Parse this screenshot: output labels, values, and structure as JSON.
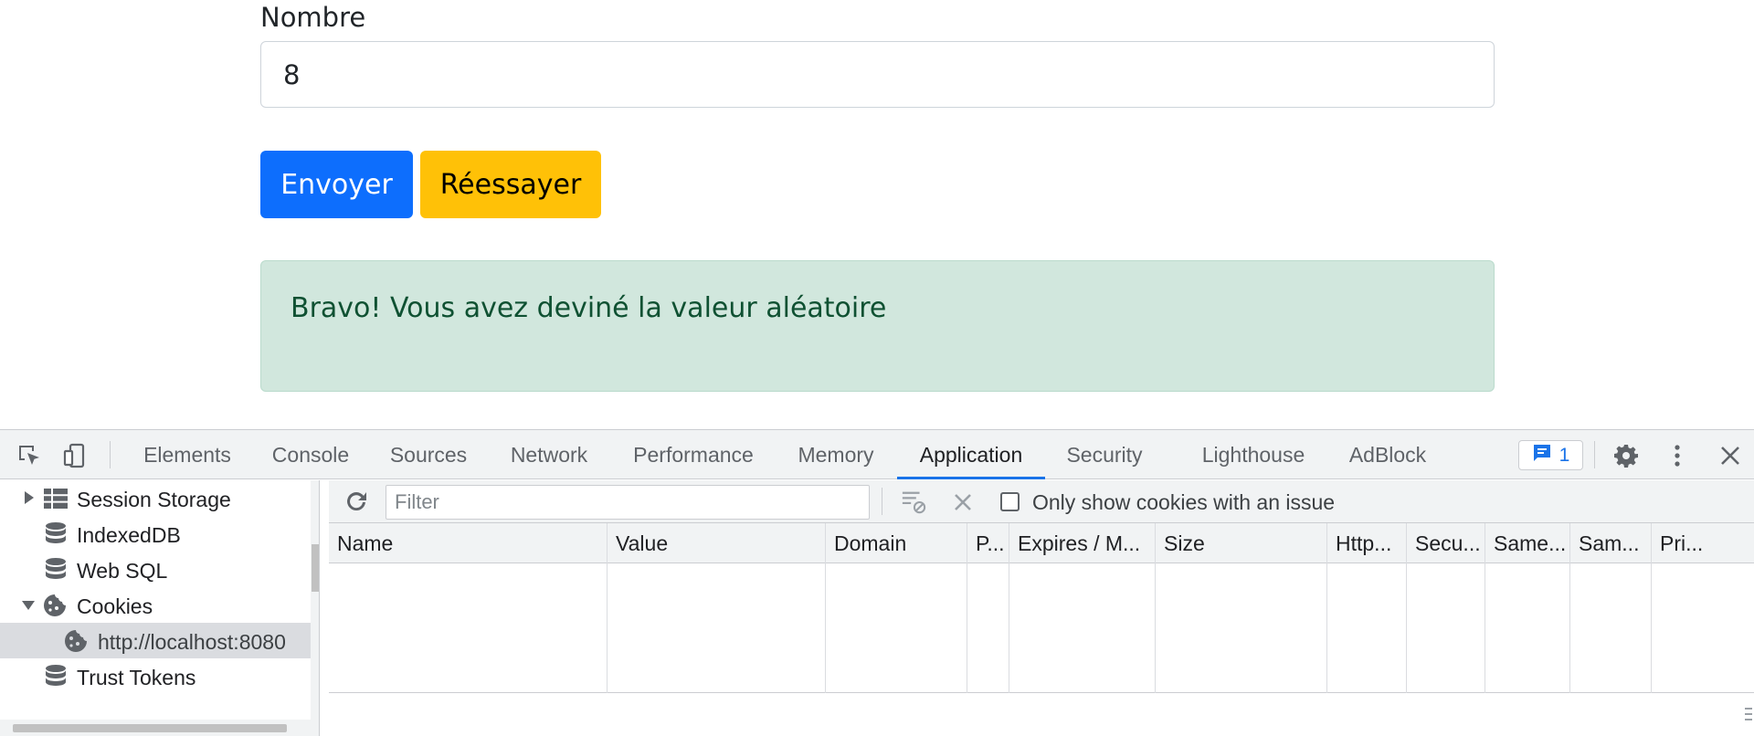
{
  "page": {
    "field_label": "Nombre",
    "number_value": "8",
    "send_button": "Envoyer",
    "retry_button": "Réessayer",
    "alert_text": "Bravo! Vous avez deviné la valeur aléatoire",
    "colors": {
      "primary": "#0d6efd",
      "warning": "#ffc107",
      "success_bg": "#d1e7dd",
      "success_text": "#0f5132"
    }
  },
  "devtools": {
    "tabs": [
      "Elements",
      "Console",
      "Sources",
      "Network",
      "Performance",
      "Memory",
      "Application",
      "Security",
      "Lighthouse",
      "AdBlock"
    ],
    "active_tab": "Application",
    "issues_count": "1",
    "sidebar": {
      "items": [
        {
          "label": "Session Storage",
          "icon": "table-icon",
          "expander": "collapsed"
        },
        {
          "label": "IndexedDB",
          "icon": "database-icon"
        },
        {
          "label": "Web SQL",
          "icon": "database-icon"
        },
        {
          "label": "Cookies",
          "icon": "cookie-icon",
          "expander": "expanded"
        },
        {
          "label": "http://localhost:8080",
          "icon": "cookie-icon",
          "selected": true
        },
        {
          "label": "Trust Tokens",
          "icon": "database-icon"
        }
      ]
    },
    "cookies": {
      "filter_placeholder": "Filter",
      "only_issues_label": "Only show cookies with an issue",
      "only_issues_checked": false,
      "columns": [
        "Name",
        "Value",
        "Domain",
        "P...",
        "Expires / M...",
        "Size",
        "Http...",
        "Secu...",
        "Same...",
        "Sam...",
        "Pri..."
      ],
      "rows": []
    },
    "accent": "#1a73e8"
  }
}
